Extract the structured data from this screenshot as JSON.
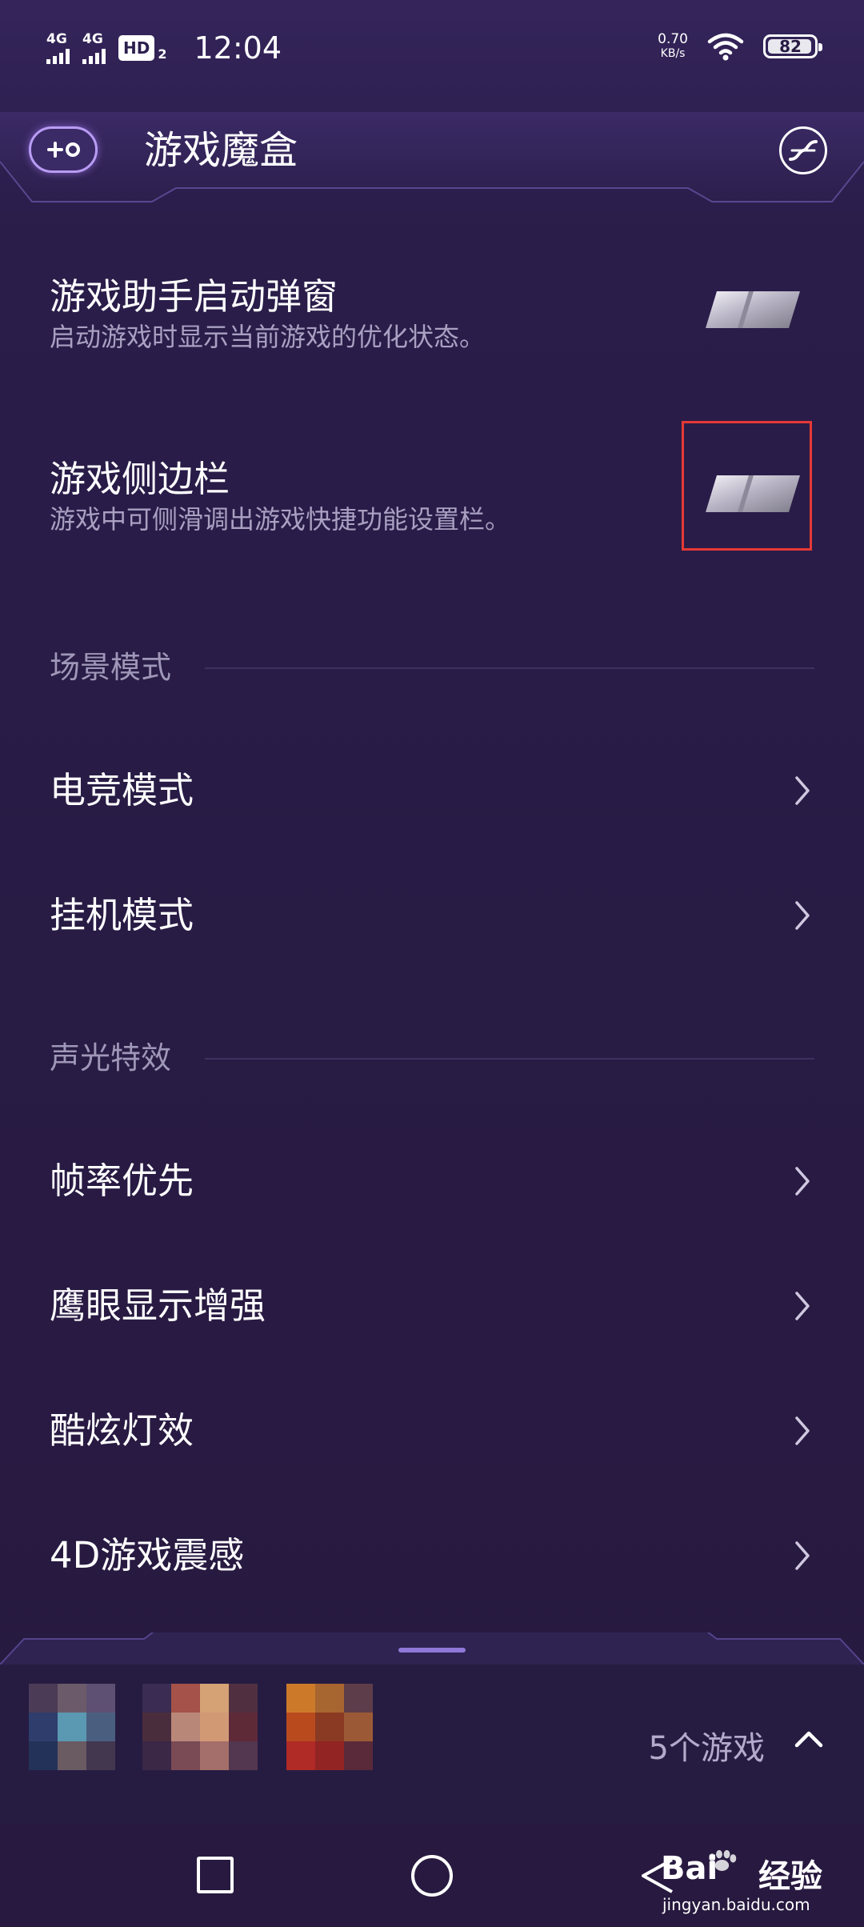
{
  "status_bar": {
    "sim1": "4G",
    "sim2": "4G",
    "hd": "HD",
    "hd_sub": "2",
    "time": "12:04",
    "net_speed_value": "0.70",
    "net_speed_unit": "KB/s",
    "battery": "82"
  },
  "header": {
    "title": "游戏魔盒"
  },
  "settings": [
    {
      "title": "游戏助手启动弹窗",
      "desc": "启动游戏时显示当前游戏的优化状态。"
    },
    {
      "title": "游戏侧边栏",
      "desc": "游戏中可侧滑调出游戏快捷功能设置栏。"
    }
  ],
  "sections": {
    "scene": {
      "label": "场景模式",
      "items": [
        "电竞模式",
        "挂机模式"
      ]
    },
    "effects": {
      "label": "声光特效",
      "items": [
        "帧率优先",
        "鹰眼显示增强",
        "酷炫灯效",
        "4D游戏震感"
      ]
    }
  },
  "bottom_panel": {
    "game_count": "5个游戏"
  },
  "watermark": {
    "brand": "Bai",
    "brand_cn": "经验",
    "url": "jingyan.baidu.com"
  },
  "colors": {
    "background": "#281c45",
    "accent": "#8f78d8",
    "highlight": "#e53935"
  }
}
